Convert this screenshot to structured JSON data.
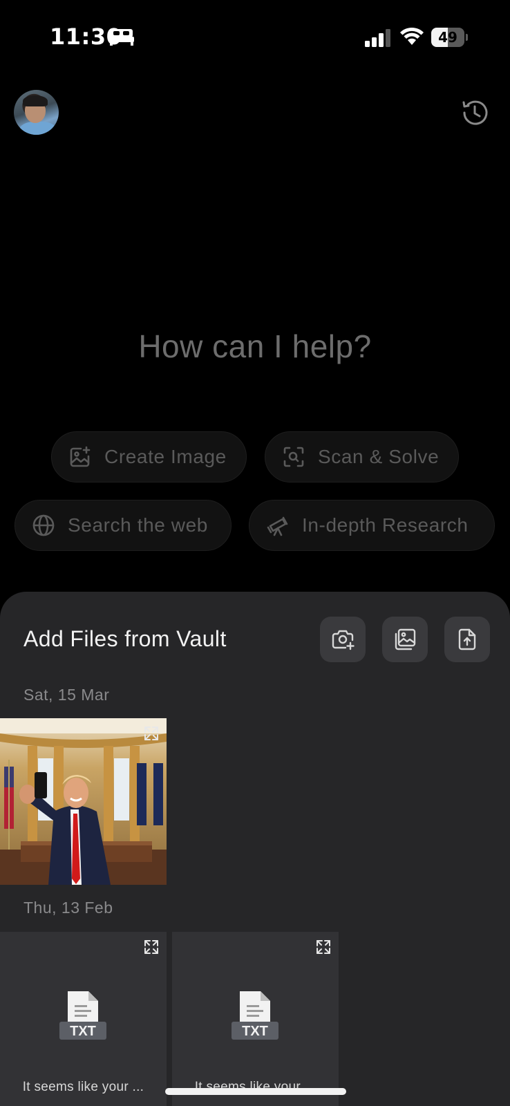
{
  "status_bar": {
    "time": "11:30",
    "battery_percent": "49",
    "battery_level": 0.49,
    "icons": [
      "bed-icon",
      "cellular-signal-icon",
      "wifi-icon",
      "battery-icon"
    ]
  },
  "header": {
    "avatar": "profile-avatar",
    "history_icon": "history-icon"
  },
  "main": {
    "greeting": "How can I help?",
    "actions": [
      {
        "label": "Create Image",
        "icon": "image-add-icon"
      },
      {
        "label": "Scan & Solve",
        "icon": "scan-icon"
      },
      {
        "label": "Search the web",
        "icon": "globe-icon"
      },
      {
        "label": "In-depth Research",
        "icon": "telescope-icon"
      }
    ]
  },
  "sheet": {
    "title": "Add Files from Vault",
    "buttons": [
      {
        "icon": "camera-add-icon"
      },
      {
        "icon": "gallery-icon"
      },
      {
        "icon": "file-upload-icon"
      }
    ],
    "groups": [
      {
        "date": "Sat, 15 Mar",
        "items": [
          {
            "type": "image",
            "icon": "expand-icon"
          }
        ]
      },
      {
        "date": "Thu, 13 Feb",
        "items": [
          {
            "type": "txt",
            "badge": "TXT",
            "caption": "It seems like your ..."
          },
          {
            "type": "txt",
            "badge": "TXT",
            "caption": "It seems like your ..."
          }
        ]
      }
    ]
  },
  "colors": {
    "background": "#000000",
    "sheet": "#262628",
    "chip_text": "#5a5a5a",
    "greeting": "#6d6d6d"
  }
}
